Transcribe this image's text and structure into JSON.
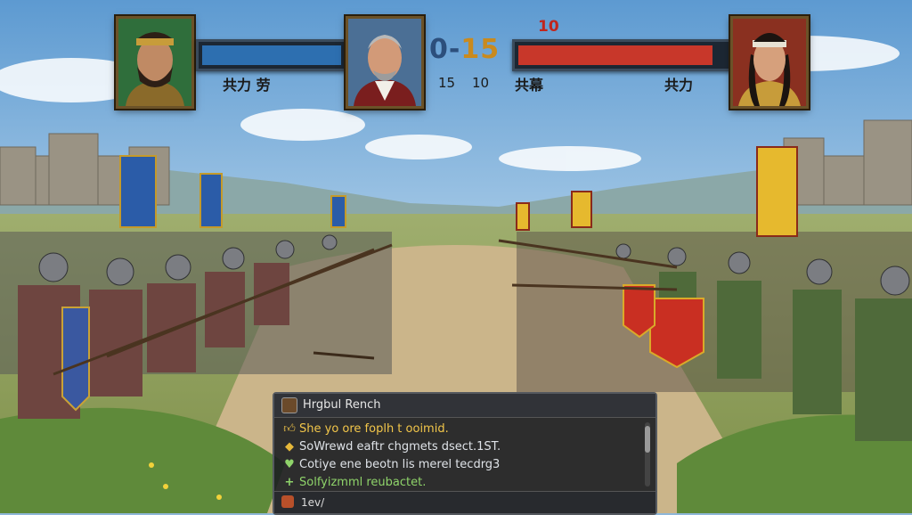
{
  "hud": {
    "left_general_label": "共力 劳",
    "center_score_left": "0",
    "center_score_sep": "-",
    "center_score_right": "15",
    "center_sub_left": "15",
    "center_sub_right": "10",
    "right_top_number": "10",
    "right_label_1": "共幕",
    "right_label_2": "共力",
    "left_bar_percent": 100,
    "right_bar_percent": 94,
    "colors": {
      "left_bar": "#2d6fb0",
      "right_bar": "#c8372a",
      "score_left": "#2c4f7c",
      "score_right": "#c98a1e",
      "top_red": "#c0261d"
    }
  },
  "chat": {
    "title": "Hrgbul Rench",
    "lines": [
      {
        "icon": "thumb-icon",
        "text": "She yo ore foplh t ooimid.",
        "color": "#f2c64a"
      },
      {
        "icon": "shield-icon",
        "text": "SoWrewd eaftr chgmets dsect.1ST.",
        "color": "#e0e6ec"
      },
      {
        "icon": "heart-icon",
        "text": "Cotiye ene beotn lis merel tecdrg3",
        "color": "#e0e6ec"
      },
      {
        "icon": "plus-icon",
        "text": "Solfyizmml reubactet.",
        "color": "#8fd46a"
      }
    ],
    "input_text": "1ev/"
  }
}
